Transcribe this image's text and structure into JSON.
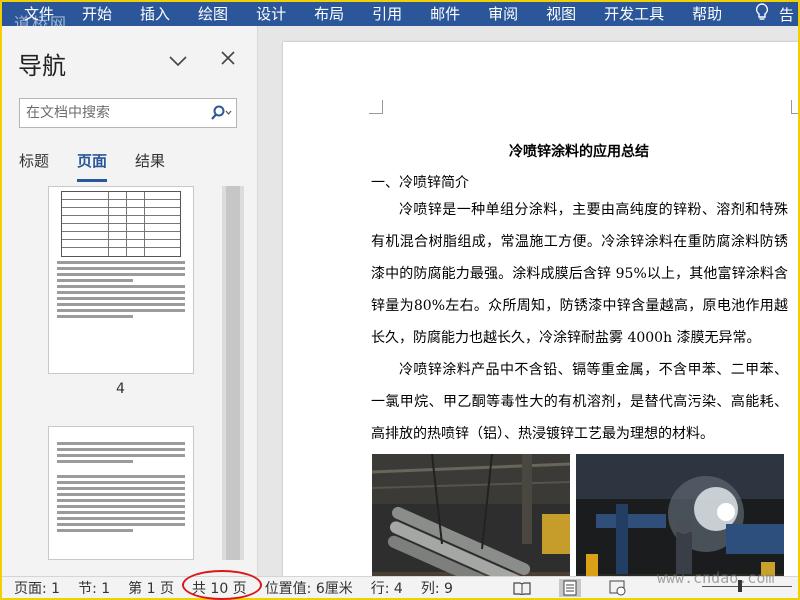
{
  "ribbon": {
    "tabs": [
      "文件",
      "开始",
      "插入",
      "绘图",
      "设计",
      "布局",
      "引用",
      "邮件",
      "审阅",
      "视图",
      "开发工具",
      "帮助"
    ],
    "tell_me_icon": "lightbulb-icon",
    "tail_label": "告",
    "color": "#2b579a"
  },
  "watermark_top": "道桥网",
  "nav": {
    "title": "导航",
    "search_placeholder": "在文档中搜索",
    "tabs": [
      "标题",
      "页面",
      "结果"
    ],
    "active_tab": "页面",
    "thumb_page_number": "4"
  },
  "document": {
    "title": "冷喷锌涂料的应用总结",
    "heading": "一、冷喷锌简介",
    "paragraph1": "冷喷锌是一种单组分涂料，主要由高纯度的锌粉、溶剂和特殊有机混合树脂组成，常温施工方便。冷涂锌涂料在重防腐涂料防锈漆中的防腐能力最强。涂料成膜后含锌 95%以上，其他富锌涂料含锌量为80%左右。众所周知，防锈漆中锌含量越高，原电池作用越长久，防腐能力也越长久，冷涂锌耐盐雾 4000h 漆膜无异常。",
    "paragraph2": "冷喷锌涂料产品中不含铅、镉等重金属，不含甲苯、二甲苯、一氯甲烷、甲乙酮等毒性大的有机溶剂，是替代高污染、高能耗、高排放的热喷锌（铝）、热浸镀锌工艺最为理想的材料。"
  },
  "status": {
    "page": "页面: 1",
    "section": "节: 1",
    "page_of": "第 1 页",
    "total": "共 10 页",
    "position": "位置值: 6厘米",
    "line": "行: 4",
    "column": "列: 9"
  },
  "watermark_bottom": "www.cndao.com",
  "colors": {
    "accent": "#2b579a",
    "highlight_ring": "#d81818",
    "border": "#f0d000"
  }
}
